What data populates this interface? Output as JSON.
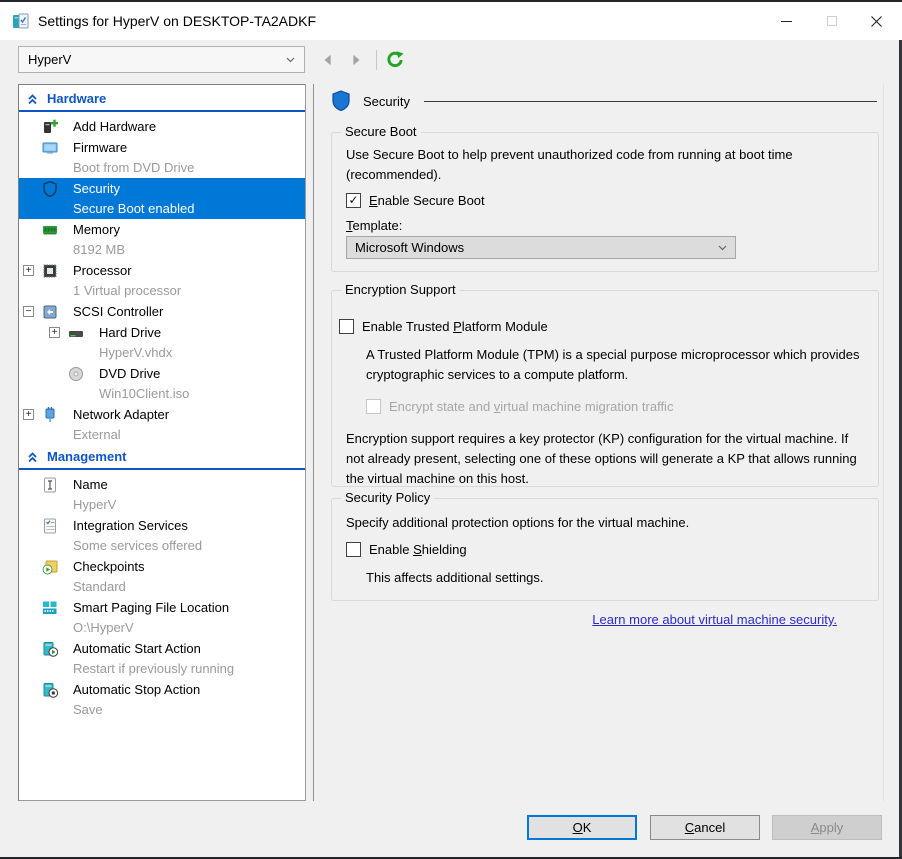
{
  "window": {
    "title": "Settings for HyperV on DESKTOP-TA2ADKF"
  },
  "toolbar": {
    "vm_selector_value": "HyperV"
  },
  "sidebar": {
    "sections": [
      {
        "label": "Hardware",
        "items": [
          {
            "label": "Add Hardware"
          },
          {
            "label": "Firmware",
            "sub": "Boot from DVD Drive"
          },
          {
            "label": "Security",
            "sub": "Secure Boot enabled",
            "selected": true
          },
          {
            "label": "Memory",
            "sub": "8192 MB"
          },
          {
            "label": "Processor",
            "sub": "1 Virtual processor",
            "exp": "+"
          },
          {
            "label": "SCSI Controller",
            "exp": "−"
          },
          {
            "label": "Hard Drive",
            "sub": "HyperV.vhdx",
            "exp": "+"
          },
          {
            "label": "DVD Drive",
            "sub": "Win10Client.iso"
          },
          {
            "label": "Network Adapter",
            "sub": "External",
            "exp": "+"
          }
        ]
      },
      {
        "label": "Management",
        "items": [
          {
            "label": "Name",
            "sub": "HyperV"
          },
          {
            "label": "Integration Services",
            "sub": "Some services offered"
          },
          {
            "label": "Checkpoints",
            "sub": "Standard"
          },
          {
            "label": "Smart Paging File Location",
            "sub": "O:\\HyperV"
          },
          {
            "label": "Automatic Start Action",
            "sub": "Restart if previously running"
          },
          {
            "label": "Automatic Stop Action",
            "sub": "Save"
          }
        ]
      }
    ]
  },
  "panel": {
    "header": "Security",
    "secure_boot": {
      "legend": "Secure Boot",
      "desc": "Use Secure Boot to help prevent unauthorized code from running at boot time (recommended).",
      "enable_checkbox": {
        "pre": "",
        "key": "E",
        "post": "nable Secure Boot",
        "checked": true,
        "check_glyph": "✓"
      },
      "template_label": {
        "pre": "",
        "key": "T",
        "post": "emplate:"
      },
      "template_value": "Microsoft Windows"
    },
    "encryption": {
      "legend": "Encryption Support",
      "tpm_checkbox": {
        "pre": "Enable Trusted ",
        "key": "P",
        "post": "latform Module",
        "checked": false
      },
      "tpm_desc": "A Trusted Platform Module (TPM) is a special purpose microprocessor which provides cryptographic services to a compute platform.",
      "encrypt_checkbox": {
        "pre": "Encrypt state and ",
        "key": "v",
        "post": "irtual machine migration traffic",
        "checked": false,
        "disabled": true
      },
      "kp_desc": "Encryption support requires a key protector (KP) configuration for the virtual machine. If not already present, selecting one of these options will generate a KP that allows running the virtual machine on this host."
    },
    "policy": {
      "legend": "Security Policy",
      "desc": "Specify additional protection options for the virtual machine.",
      "shielding_checkbox": {
        "pre": "Enable ",
        "key": "S",
        "post": "hielding",
        "checked": false
      },
      "note": "This affects additional settings."
    },
    "link_text": "Learn more about virtual machine security."
  },
  "footer": {
    "ok": {
      "pre": "",
      "key": "O",
      "post": "K"
    },
    "cancel": {
      "pre": "",
      "key": "C",
      "post": "ancel"
    },
    "apply": {
      "pre": "",
      "key": "A",
      "post": "pply"
    }
  },
  "colors": {
    "selection_blue": "#0078d7",
    "section_header_blue": "#0f56c4",
    "link_blue": "#2a2ac9",
    "refresh_green": "#24a324"
  }
}
